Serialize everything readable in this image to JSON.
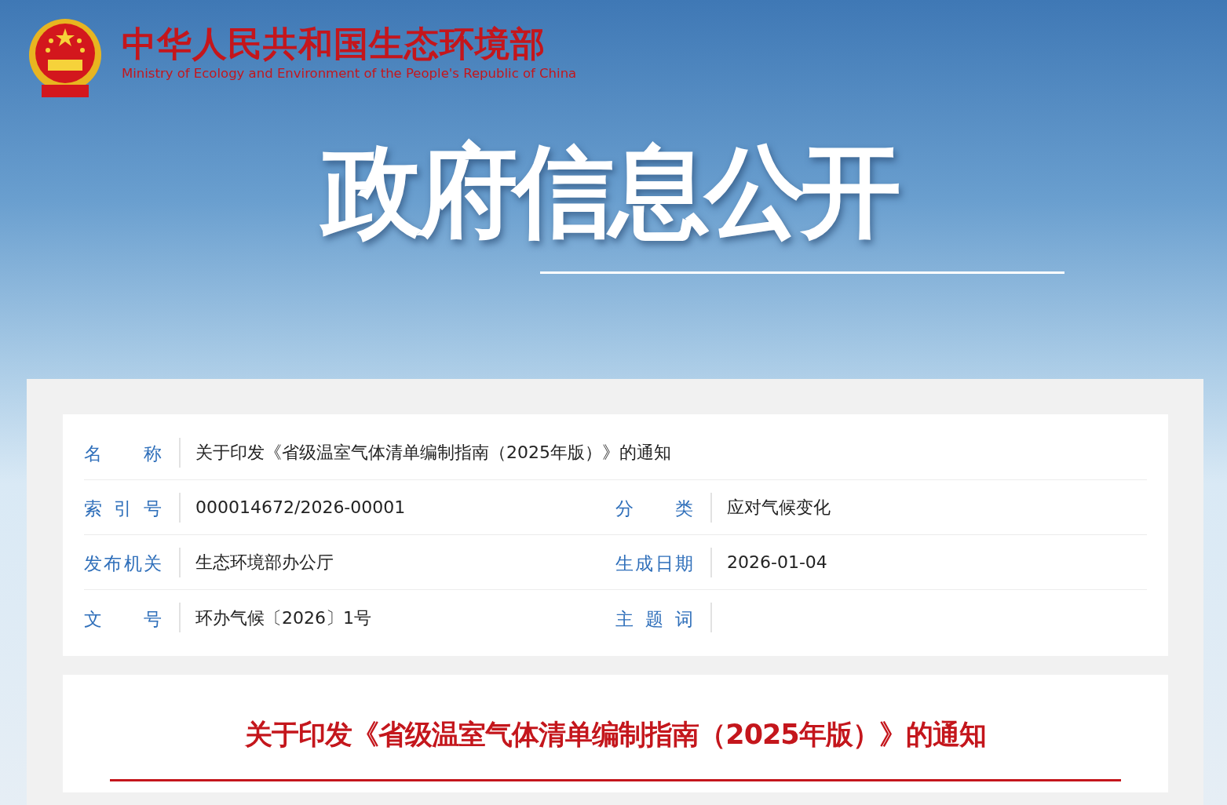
{
  "header": {
    "title_cn": "中华人民共和国生态环境部",
    "title_en": "Ministry of Ecology and Environment of the People's Republic of China",
    "banner": "政府信息公开"
  },
  "info_rows": [
    [
      {
        "label": "名 称",
        "value": "关于印发《省级温室气体清单编制指南（2025年版）》的通知"
      }
    ],
    [
      {
        "label": "索 引 号",
        "value": "000014672/2026-00001"
      },
      {
        "label": "分 类",
        "value": "应对气候变化"
      }
    ],
    [
      {
        "label": "发布机关",
        "value": "生态环境部办公厅"
      },
      {
        "label": "生成日期",
        "value": "2026-01-04"
      }
    ],
    [
      {
        "label": "文 号",
        "value": "环办气候〔2026〕1号"
      },
      {
        "label": "主 题 词"
      }
    ]
  ],
  "article": {
    "title": "关于印发《省级温室气体清单编制指南（2025年版）》的通知"
  }
}
